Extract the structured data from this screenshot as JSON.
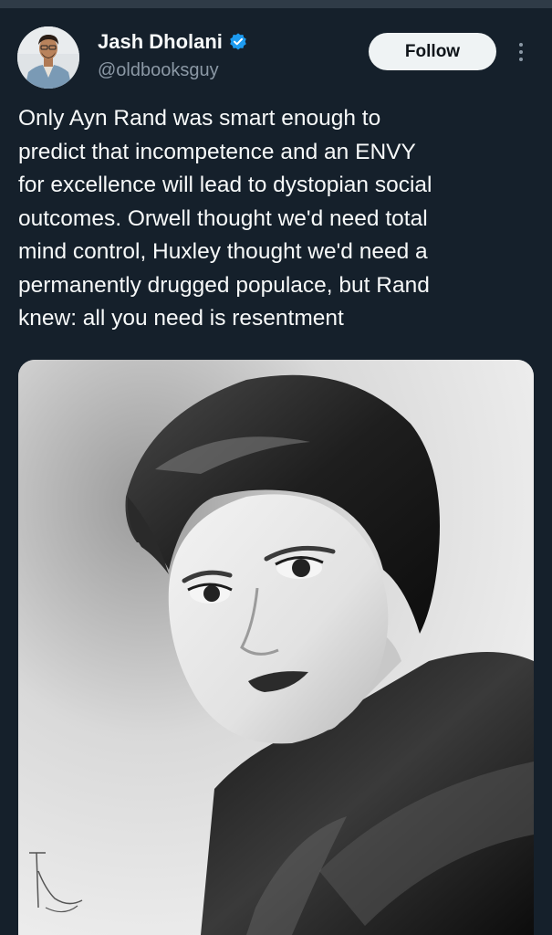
{
  "author": {
    "display_name": "Jash Dholani",
    "handle": "@oldbooksguy",
    "verified": true,
    "verified_color": "#1d9bf0"
  },
  "actions": {
    "follow_label": "Follow",
    "more_icon": "more-vertical-icon"
  },
  "tweet": {
    "text_lines": [
      "Only Ayn Rand was smart enough to",
      "predict that incompetence and an ENVY",
      "for excellence will lead to dystopian social",
      "outcomes. Orwell thought we'd need total",
      "mind control, Huxley thought we'd need a",
      "permanently drugged populace, but Rand",
      "knew: all you need is resentment"
    ]
  },
  "media": {
    "type": "black-and-white portrait photograph"
  },
  "theme": {
    "background": "#15202b",
    "text_primary": "#f7f9f9",
    "text_secondary": "#8b98a5",
    "button_bg": "#eff3f4"
  }
}
